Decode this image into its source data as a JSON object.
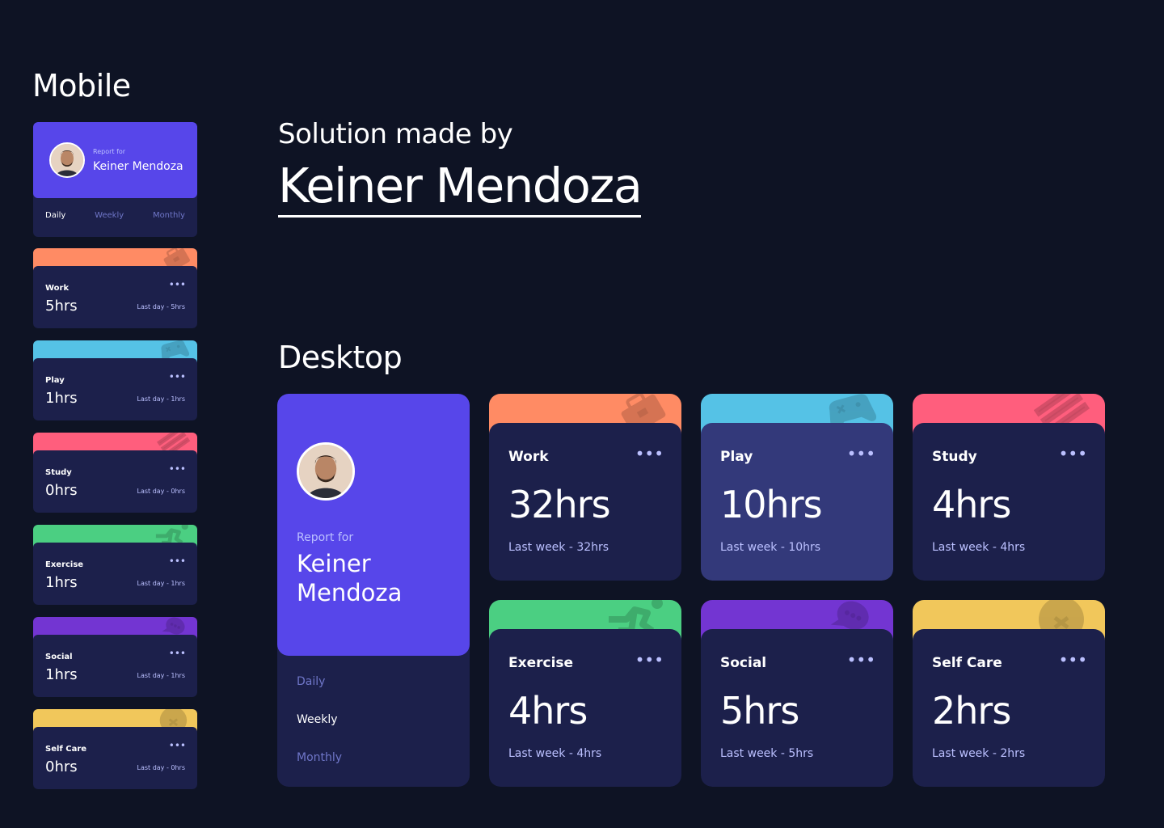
{
  "headings": {
    "mobile": "Mobile",
    "made_by": "Solution made by",
    "author": "Keiner Mendoza",
    "desktop": "Desktop"
  },
  "profile": {
    "report_for": "Report for",
    "name": "Keiner Mendoza",
    "name_line1": "Keiner",
    "name_line2": "Mendoza",
    "avatar_icon": "avatar-photo"
  },
  "mobile": {
    "tabs": [
      "Daily",
      "Weekly",
      "Monthly"
    ],
    "active_tab": "Daily",
    "cards": [
      {
        "title": "Work",
        "hours": "5hrs",
        "previous": "Last day - 5hrs",
        "color": "#ff8b64",
        "icon": "briefcase-icon"
      },
      {
        "title": "Play",
        "hours": "1hrs",
        "previous": "Last day - 1hrs",
        "color": "#55c2e6",
        "icon": "gamepad-icon"
      },
      {
        "title": "Study",
        "hours": "0hrs",
        "previous": "Last day - 0hrs",
        "color": "#ff5e7d",
        "icon": "books-icon"
      },
      {
        "title": "Exercise",
        "hours": "1hrs",
        "previous": "Last day - 1hrs",
        "color": "#4bcf82",
        "icon": "runner-icon"
      },
      {
        "title": "Social",
        "hours": "1hrs",
        "previous": "Last day - 1hrs",
        "color": "#7335d2",
        "icon": "chat-icon"
      },
      {
        "title": "Self Care",
        "hours": "0hrs",
        "previous": "Last day - 0hrs",
        "color": "#f1c75b",
        "icon": "heart-icon"
      }
    ]
  },
  "desktop": {
    "tabs": [
      "Daily",
      "Weekly",
      "Monthly"
    ],
    "active_tab": "Weekly",
    "cards": [
      {
        "title": "Work",
        "hours": "32hrs",
        "previous": "Last week - 32hrs",
        "color": "#ff8b64",
        "icon": "briefcase-icon"
      },
      {
        "title": "Play",
        "hours": "10hrs",
        "previous": "Last week - 10hrs",
        "color": "#55c2e6",
        "icon": "gamepad-icon"
      },
      {
        "title": "Study",
        "hours": "4hrs",
        "previous": "Last week - 4hrs",
        "color": "#ff5e7d",
        "icon": "books-icon"
      },
      {
        "title": "Exercise",
        "hours": "4hrs",
        "previous": "Last week - 4hrs",
        "color": "#4bcf82",
        "icon": "runner-icon"
      },
      {
        "title": "Social",
        "hours": "5hrs",
        "previous": "Last week - 5hrs",
        "color": "#7335d2",
        "icon": "chat-icon"
      },
      {
        "title": "Self Care",
        "hours": "2hrs",
        "previous": "Last week - 2hrs",
        "color": "#f1c75b",
        "icon": "heart-icon"
      }
    ]
  },
  "colors": {
    "background": "#0e1324",
    "card": "#1c204b",
    "card_hover": "#33397a",
    "profile": "#5746ea",
    "muted_text": "#bbc0ff",
    "tab_text": "#6f76c8"
  },
  "menu_icon": "ellipsis-icon",
  "dots": "•••"
}
